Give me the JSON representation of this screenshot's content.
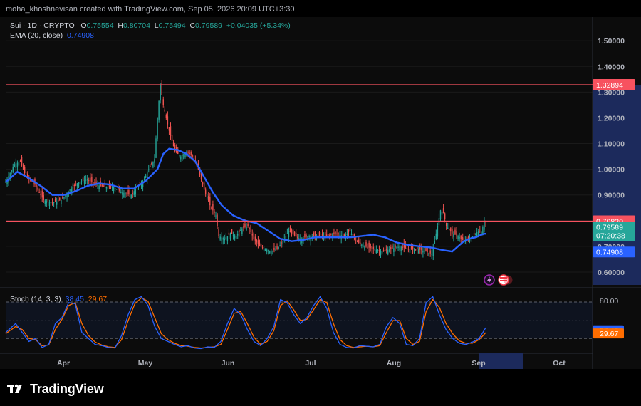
{
  "attribution": "moha_khoshnevisan created with TradingView.com, Sep 05, 2026 20:09 UTC+3:30",
  "legend": {
    "symbol": "Sui · 1D · CRYPTO",
    "open_label": "O",
    "open": "0.75554",
    "high_label": "H",
    "high": "0.80704",
    "low_label": "L",
    "low": "0.75494",
    "close_label": "C",
    "close": "0.79589",
    "change": "+0.04035 (+5.34%)",
    "ema_label": "EMA (20, close)",
    "ema_value": "0.74908"
  },
  "stoch_legend": {
    "label": "Stoch (14, 3, 3)",
    "k": "38.45",
    "d": "29.67"
  },
  "brand": "TradingView",
  "colors": {
    "up": "#26a69a",
    "down": "#ef5350",
    "ema": "#2962ff",
    "stoch_k": "#2962ff",
    "stoch_d": "#ff6d00",
    "hline": "#f7525f"
  },
  "chart_data": {
    "type": "candlestick",
    "price_axis": {
      "ticks": [
        "1.50000",
        "1.40000",
        "1.30000",
        "1.20000",
        "1.10000",
        "1.00000",
        "0.90000",
        "0.80000",
        "0.70000",
        "0.60000"
      ],
      "ylim": [
        0.55,
        1.52
      ]
    },
    "time_axis": {
      "ticks": [
        "Apr",
        "May",
        "Jun",
        "Jul",
        "Aug",
        "Sep",
        "Oct"
      ]
    },
    "horizontal_lines": [
      {
        "value": 1.32894,
        "label": "1.32894"
      },
      {
        "value": 0.7982,
        "label": "0.79820"
      }
    ],
    "price_labels": {
      "last": "0.79589",
      "countdown": "07:20:38",
      "ema": "0.74908"
    },
    "ema_anchors": [
      [
        0,
        0.95
      ],
      [
        8,
        0.99
      ],
      [
        16,
        0.965
      ],
      [
        24,
        0.935
      ],
      [
        32,
        0.9
      ],
      [
        40,
        0.9
      ],
      [
        48,
        0.915
      ],
      [
        56,
        0.935
      ],
      [
        64,
        0.945
      ],
      [
        72,
        0.94
      ],
      [
        80,
        0.925
      ],
      [
        88,
        0.925
      ],
      [
        96,
        0.955
      ],
      [
        104,
        1.0
      ],
      [
        108,
        1.06
      ],
      [
        112,
        1.08
      ],
      [
        118,
        1.075
      ],
      [
        124,
        1.06
      ],
      [
        130,
        1.03
      ],
      [
        136,
        0.97
      ],
      [
        142,
        0.91
      ],
      [
        148,
        0.86
      ],
      [
        156,
        0.82
      ],
      [
        164,
        0.8
      ],
      [
        172,
        0.79
      ],
      [
        180,
        0.76
      ],
      [
        188,
        0.73
      ],
      [
        196,
        0.72
      ],
      [
        204,
        0.725
      ],
      [
        212,
        0.735
      ],
      [
        220,
        0.735
      ],
      [
        228,
        0.735
      ],
      [
        236,
        0.735
      ],
      [
        244,
        0.74
      ],
      [
        252,
        0.745
      ],
      [
        260,
        0.735
      ],
      [
        268,
        0.715
      ],
      [
        276,
        0.705
      ],
      [
        284,
        0.7
      ],
      [
        292,
        0.695
      ],
      [
        300,
        0.685
      ],
      [
        306,
        0.68
      ],
      [
        310,
        0.7
      ],
      [
        314,
        0.72
      ],
      [
        318,
        0.73
      ],
      [
        322,
        0.735
      ],
      [
        326,
        0.745
      ],
      [
        328,
        0.749
      ]
    ],
    "candle_anchors": [
      [
        0,
        0.95
      ],
      [
        6,
        1.02
      ],
      [
        10,
        1.03
      ],
      [
        14,
        0.97
      ],
      [
        20,
        0.94
      ],
      [
        26,
        0.88
      ],
      [
        32,
        0.87
      ],
      [
        38,
        0.88
      ],
      [
        44,
        0.92
      ],
      [
        50,
        0.95
      ],
      [
        56,
        0.96
      ],
      [
        62,
        0.94
      ],
      [
        68,
        0.93
      ],
      [
        74,
        0.93
      ],
      [
        80,
        0.91
      ],
      [
        86,
        0.9
      ],
      [
        90,
        0.93
      ],
      [
        94,
        0.95
      ],
      [
        98,
        1.0
      ],
      [
        102,
        1.04
      ],
      [
        104,
        1.2
      ],
      [
        106,
        1.33
      ],
      [
        108,
        1.25
      ],
      [
        112,
        1.15
      ],
      [
        116,
        1.07
      ],
      [
        120,
        1.05
      ],
      [
        124,
        1.07
      ],
      [
        128,
        1.05
      ],
      [
        132,
        1.0
      ],
      [
        136,
        0.92
      ],
      [
        140,
        0.86
      ],
      [
        144,
        0.82
      ],
      [
        146,
        0.74
      ],
      [
        150,
        0.73
      ],
      [
        154,
        0.75
      ],
      [
        158,
        0.74
      ],
      [
        162,
        0.77
      ],
      [
        166,
        0.78
      ],
      [
        170,
        0.73
      ],
      [
        174,
        0.7
      ],
      [
        178,
        0.69
      ],
      [
        182,
        0.68
      ],
      [
        186,
        0.69
      ],
      [
        190,
        0.72
      ],
      [
        194,
        0.76
      ],
      [
        198,
        0.74
      ],
      [
        202,
        0.73
      ],
      [
        208,
        0.74
      ],
      [
        214,
        0.74
      ],
      [
        220,
        0.74
      ],
      [
        226,
        0.75
      ],
      [
        232,
        0.74
      ],
      [
        236,
        0.76
      ],
      [
        240,
        0.72
      ],
      [
        246,
        0.7
      ],
      [
        252,
        0.69
      ],
      [
        258,
        0.68
      ],
      [
        264,
        0.69
      ],
      [
        270,
        0.7
      ],
      [
        276,
        0.69
      ],
      [
        282,
        0.69
      ],
      [
        288,
        0.68
      ],
      [
        292,
        0.67
      ],
      [
        294,
        0.72
      ],
      [
        296,
        0.78
      ],
      [
        298,
        0.84
      ],
      [
        300,
        0.83
      ],
      [
        302,
        0.78
      ],
      [
        306,
        0.75
      ],
      [
        310,
        0.74
      ],
      [
        314,
        0.72
      ],
      [
        318,
        0.73
      ],
      [
        322,
        0.75
      ],
      [
        324,
        0.76
      ],
      [
        326,
        0.755
      ],
      [
        328,
        0.796
      ]
    ],
    "stoch": {
      "ylim": [
        0,
        100
      ],
      "levels": [
        80,
        20
      ],
      "tick_labels": [
        "80.00"
      ],
      "k_anchors": [
        [
          0,
          30
        ],
        [
          6,
          45
        ],
        [
          10,
          30
        ],
        [
          14,
          15
        ],
        [
          18,
          20
        ],
        [
          22,
          5
        ],
        [
          26,
          10
        ],
        [
          30,
          45
        ],
        [
          34,
          55
        ],
        [
          38,
          80
        ],
        [
          42,
          78
        ],
        [
          46,
          30
        ],
        [
          50,
          20
        ],
        [
          54,
          10
        ],
        [
          58,
          8
        ],
        [
          62,
          5
        ],
        [
          66,
          4
        ],
        [
          70,
          25
        ],
        [
          74,
          60
        ],
        [
          78,
          85
        ],
        [
          82,
          90
        ],
        [
          86,
          75
        ],
        [
          90,
          40
        ],
        [
          94,
          20
        ],
        [
          98,
          15
        ],
        [
          102,
          10
        ],
        [
          106,
          6
        ],
        [
          110,
          8
        ],
        [
          114,
          4
        ],
        [
          118,
          3
        ],
        [
          122,
          6
        ],
        [
          126,
          5
        ],
        [
          130,
          15
        ],
        [
          134,
          45
        ],
        [
          138,
          70
        ],
        [
          142,
          60
        ],
        [
          146,
          35
        ],
        [
          150,
          15
        ],
        [
          154,
          8
        ],
        [
          158,
          20
        ],
        [
          162,
          40
        ],
        [
          166,
          85
        ],
        [
          170,
          80
        ],
        [
          174,
          60
        ],
        [
          178,
          45
        ],
        [
          182,
          55
        ],
        [
          186,
          75
        ],
        [
          190,
          90
        ],
        [
          194,
          70
        ],
        [
          198,
          30
        ],
        [
          202,
          10
        ],
        [
          206,
          5
        ],
        [
          210,
          4
        ],
        [
          214,
          8
        ],
        [
          218,
          7
        ],
        [
          222,
          6
        ],
        [
          226,
          10
        ],
        [
          230,
          40
        ],
        [
          234,
          55
        ],
        [
          238,
          45
        ],
        [
          242,
          10
        ],
        [
          246,
          8
        ],
        [
          250,
          20
        ],
        [
          254,
          80
        ],
        [
          258,
          90
        ],
        [
          262,
          60
        ],
        [
          266,
          35
        ],
        [
          270,
          20
        ],
        [
          274,
          12
        ],
        [
          278,
          10
        ],
        [
          282,
          14
        ],
        [
          286,
          20
        ],
        [
          290,
          38
        ]
      ],
      "d_anchors": [
        [
          0,
          28
        ],
        [
          6,
          40
        ],
        [
          10,
          35
        ],
        [
          14,
          20
        ],
        [
          18,
          18
        ],
        [
          22,
          8
        ],
        [
          26,
          9
        ],
        [
          30,
          35
        ],
        [
          34,
          52
        ],
        [
          38,
          75
        ],
        [
          42,
          80
        ],
        [
          46,
          45
        ],
        [
          50,
          25
        ],
        [
          54,
          14
        ],
        [
          58,
          9
        ],
        [
          62,
          6
        ],
        [
          66,
          5
        ],
        [
          70,
          18
        ],
        [
          74,
          50
        ],
        [
          78,
          78
        ],
        [
          82,
          88
        ],
        [
          86,
          82
        ],
        [
          90,
          55
        ],
        [
          94,
          28
        ],
        [
          98,
          18
        ],
        [
          102,
          12
        ],
        [
          106,
          8
        ],
        [
          110,
          7
        ],
        [
          114,
          5
        ],
        [
          118,
          4
        ],
        [
          122,
          5
        ],
        [
          126,
          6
        ],
        [
          130,
          10
        ],
        [
          134,
          35
        ],
        [
          138,
          62
        ],
        [
          142,
          65
        ],
        [
          146,
          45
        ],
        [
          150,
          22
        ],
        [
          154,
          10
        ],
        [
          158,
          15
        ],
        [
          162,
          33
        ],
        [
          166,
          75
        ],
        [
          170,
          83
        ],
        [
          174,
          68
        ],
        [
          178,
          50
        ],
        [
          182,
          52
        ],
        [
          186,
          68
        ],
        [
          190,
          85
        ],
        [
          194,
          80
        ],
        [
          198,
          45
        ],
        [
          202,
          18
        ],
        [
          206,
          8
        ],
        [
          210,
          5
        ],
        [
          214,
          6
        ],
        [
          218,
          7
        ],
        [
          222,
          6
        ],
        [
          226,
          8
        ],
        [
          230,
          30
        ],
        [
          234,
          50
        ],
        [
          238,
          50
        ],
        [
          242,
          20
        ],
        [
          246,
          10
        ],
        [
          250,
          15
        ],
        [
          254,
          65
        ],
        [
          258,
          85
        ],
        [
          262,
          72
        ],
        [
          266,
          45
        ],
        [
          270,
          28
        ],
        [
          274,
          16
        ],
        [
          278,
          12
        ],
        [
          282,
          12
        ],
        [
          286,
          18
        ],
        [
          290,
          29.67
        ]
      ]
    }
  }
}
